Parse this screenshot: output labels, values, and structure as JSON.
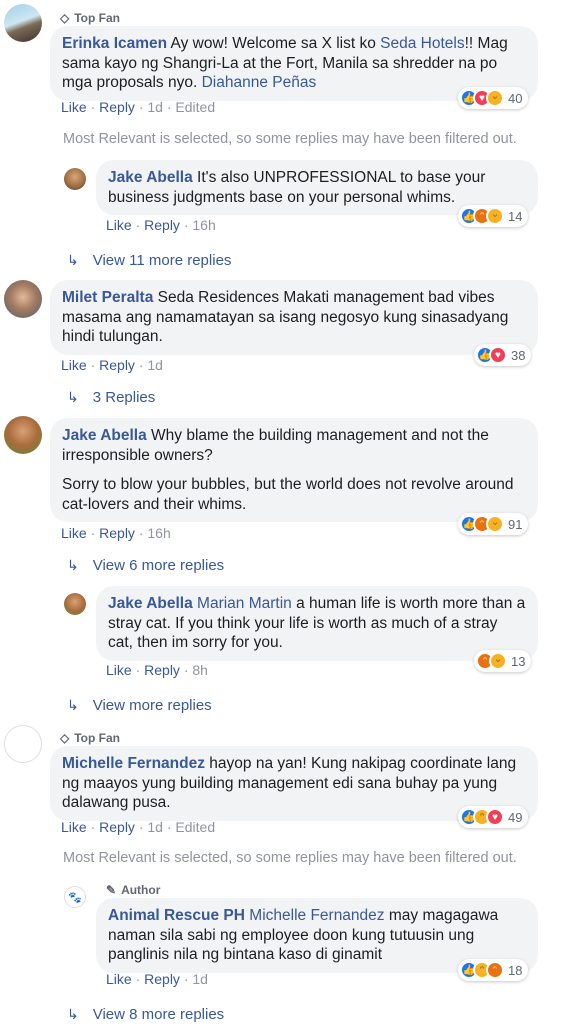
{
  "common": {
    "like": "Like",
    "reply": "Reply",
    "dot": "·",
    "filter_notice": "Most Relevant is selected, so some replies may have been filtered out."
  },
  "c1": {
    "badge": "Top Fan",
    "name": "Erinka Icamen",
    "text_a": " Ay wow! Welcome sa X list ko ",
    "mention_a": "Seda Hotels",
    "text_b": "!! Mag sama kayo ng Shangri-La at the Fort, Manila sa shredder na po mga proposals nyo. ",
    "mention_b": "Diahanne Peñas",
    "time": "1d",
    "edited": "Edited",
    "reactions": [
      "like",
      "love",
      "haha"
    ],
    "count": "40"
  },
  "r1": {
    "name": "Jake Abella",
    "text": " It's also UNPROFESSIONAL to base your business judgments base on your personal whims.",
    "time": "16h",
    "reactions": [
      "like",
      "angry",
      "haha"
    ],
    "count": "14"
  },
  "more1": "View 11 more replies",
  "c2": {
    "name": "Milet Peralta",
    "text": " Seda Residences Makati management bad vibes masama ang namamatayan sa isang negosyo kung sinasadyang hindi tulungan.",
    "time": "1d",
    "reactions": [
      "like",
      "love"
    ],
    "count": "38"
  },
  "more2": "3 Replies",
  "c3": {
    "name": "Jake Abella",
    "text_a": " Why blame the building management and not the irresponsible owners?",
    "text_b": "Sorry to blow your bubbles, but the world does not revolve around cat-lovers and their whims.",
    "time": "16h",
    "reactions": [
      "like",
      "angry",
      "haha"
    ],
    "count": "91"
  },
  "more3": "View 6 more replies",
  "r3": {
    "name": "Jake Abella",
    "mention": "Marian Martin",
    "text": " a human life is worth more than a stray cat. If you think your life is worth as much of a stray cat, then im sorry for you.",
    "time": "8h",
    "reactions": [
      "angry",
      "haha"
    ],
    "count": "13"
  },
  "more3b": "View more replies",
  "c4": {
    "badge": "Top Fan",
    "name": "Michelle Fernandez",
    "text": " hayop na yan! Kung nakipag coordinate lang ng maayos yung building management edi sana buhay pa yung dalawang pusa.",
    "time": "1d",
    "edited": "Edited",
    "reactions": [
      "like",
      "sad",
      "love"
    ],
    "count": "49"
  },
  "r4": {
    "badge": "Author",
    "name": "Animal Rescue PH",
    "mention": "Michelle Fernandez",
    "text": " may magagawa naman sila sabi ng employee doon kung tutuusin ung panglinis nila ng bintana kaso di ginamit",
    "time": "1d",
    "reactions": [
      "like",
      "sad",
      "angry"
    ],
    "count": "18"
  },
  "more4": "View 8 more replies",
  "colors": {
    "link": "#385898",
    "bubble": "#f2f3f5",
    "muted": "#90949c"
  }
}
